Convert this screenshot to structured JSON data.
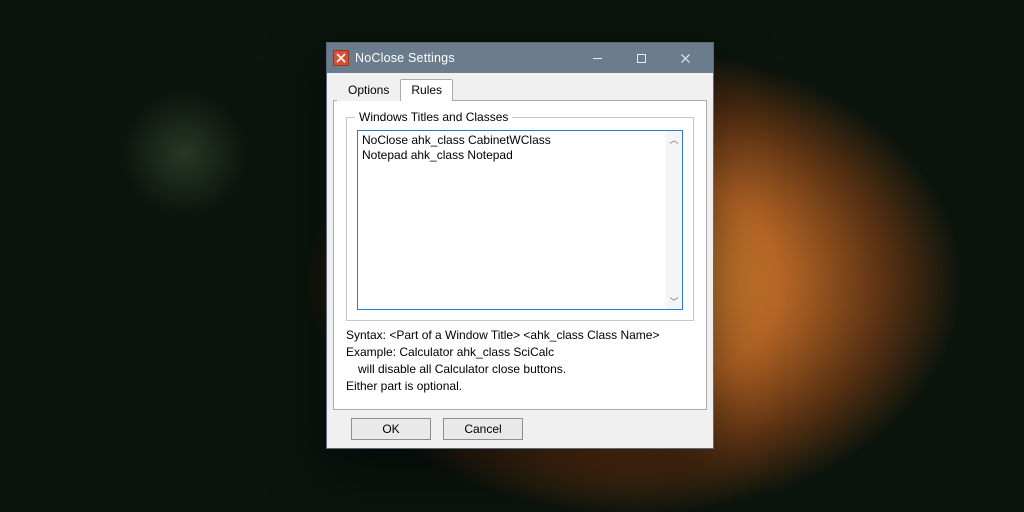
{
  "window": {
    "title": "NoClose Settings"
  },
  "tabs": {
    "options": "Options",
    "rules": "Rules",
    "active": "rules"
  },
  "group": {
    "legend": "Windows Titles and Classes"
  },
  "rules_text": "NoClose ahk_class CabinetWClass\nNotepad ahk_class Notepad",
  "help": {
    "line1": "Syntax: <Part of a Window Title> <ahk_class Class Name>",
    "line2": "Example: Calculator ahk_class SciCalc",
    "line3": "will disable all Calculator close buttons.",
    "line4": "Either part is optional."
  },
  "buttons": {
    "ok": "OK",
    "cancel": "Cancel"
  },
  "icons": {
    "app": "app-icon",
    "minimize": "minimize-icon",
    "maximize": "maximize-icon",
    "close": "close-icon",
    "scroll_up": "chevron-up-icon",
    "scroll_down": "chevron-down-icon"
  }
}
